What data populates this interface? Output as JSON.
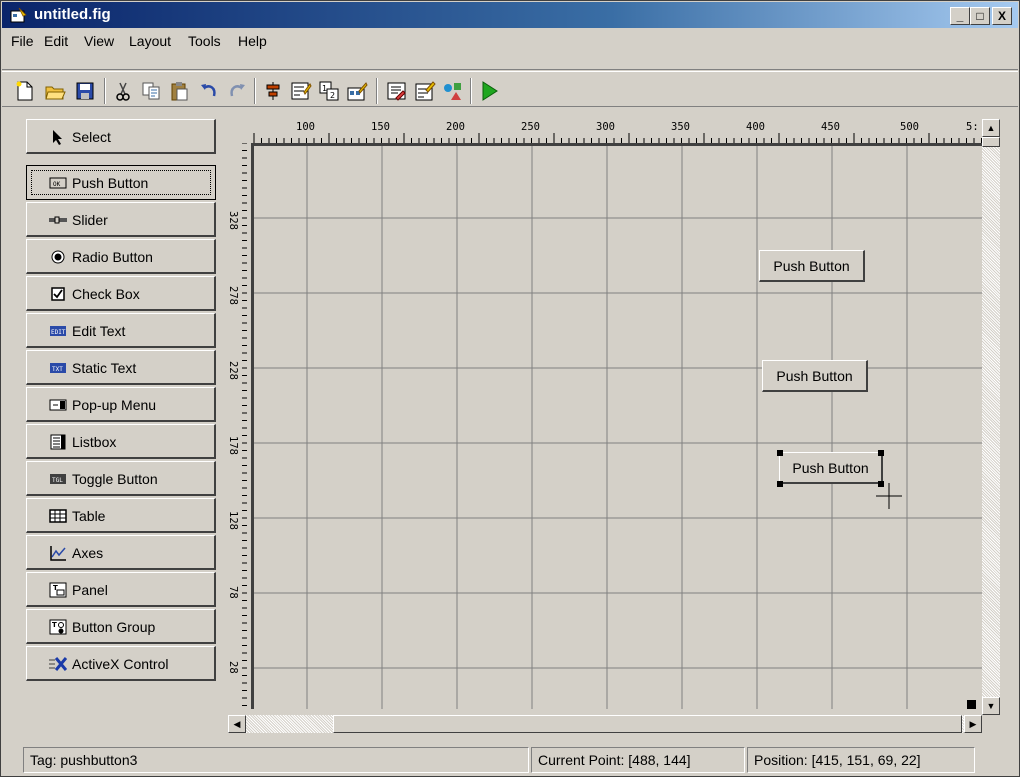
{
  "window": {
    "title": "untitled.fig",
    "minimize": "_",
    "restore": "□",
    "close": "X"
  },
  "menu": [
    "File",
    "Edit",
    "View",
    "Layout",
    "Tools",
    "Help"
  ],
  "toolbar": {
    "buttons": [
      "new-icon",
      "open-icon",
      "save-icon",
      "cut-icon",
      "copy-icon",
      "paste-icon",
      "undo-icon",
      "redo-icon",
      "align-icon",
      "menu-editor-icon",
      "tab-order-icon",
      "toolbar-editor-icon",
      "editor-icon",
      "property-inspector-icon",
      "object-browser-icon",
      "run-icon"
    ]
  },
  "palette": [
    {
      "label": "Select",
      "icon": "arrow-cursor-icon"
    },
    {
      "label": "Push Button",
      "icon": "push-button-icon",
      "selected": true
    },
    {
      "label": "Slider",
      "icon": "slider-icon"
    },
    {
      "label": "Radio Button",
      "icon": "radio-icon"
    },
    {
      "label": "Check Box",
      "icon": "checkbox-icon"
    },
    {
      "label": "Edit Text",
      "icon": "edit-text-icon",
      "glyph": "EDIT"
    },
    {
      "label": "Static Text",
      "icon": "static-text-icon",
      "glyph": "TXT"
    },
    {
      "label": "Pop-up Menu",
      "icon": "popup-menu-icon"
    },
    {
      "label": "Listbox",
      "icon": "listbox-icon"
    },
    {
      "label": "Toggle Button",
      "icon": "toggle-button-icon",
      "glyph": "TGL"
    },
    {
      "label": "Table",
      "icon": "table-icon"
    },
    {
      "label": "Axes",
      "icon": "axes-icon"
    },
    {
      "label": "Panel",
      "icon": "panel-icon"
    },
    {
      "label": "Button Group",
      "icon": "button-group-icon"
    },
    {
      "label": "ActiveX Control",
      "icon": "activex-icon"
    }
  ],
  "ruler": {
    "h_ticks": [
      "100",
      "150",
      "200",
      "250",
      "300",
      "350",
      "400",
      "450",
      "500",
      "5:"
    ],
    "v_ticks": [
      "328",
      "278",
      "228",
      "178",
      "128",
      "78",
      "28"
    ]
  },
  "canvas_buttons": [
    {
      "label": "Push Button"
    },
    {
      "label": "Push Button"
    },
    {
      "label": "Push Button",
      "selected": true
    }
  ],
  "status": {
    "tag": "Tag: pushbutton3",
    "current_point": "Current Point:  [488, 144]",
    "position": "Position: [415, 151, 69, 22]"
  },
  "colors": {
    "title_start": "#0a246a",
    "title_end": "#a6caf0",
    "run_green": "#1fa61f"
  }
}
